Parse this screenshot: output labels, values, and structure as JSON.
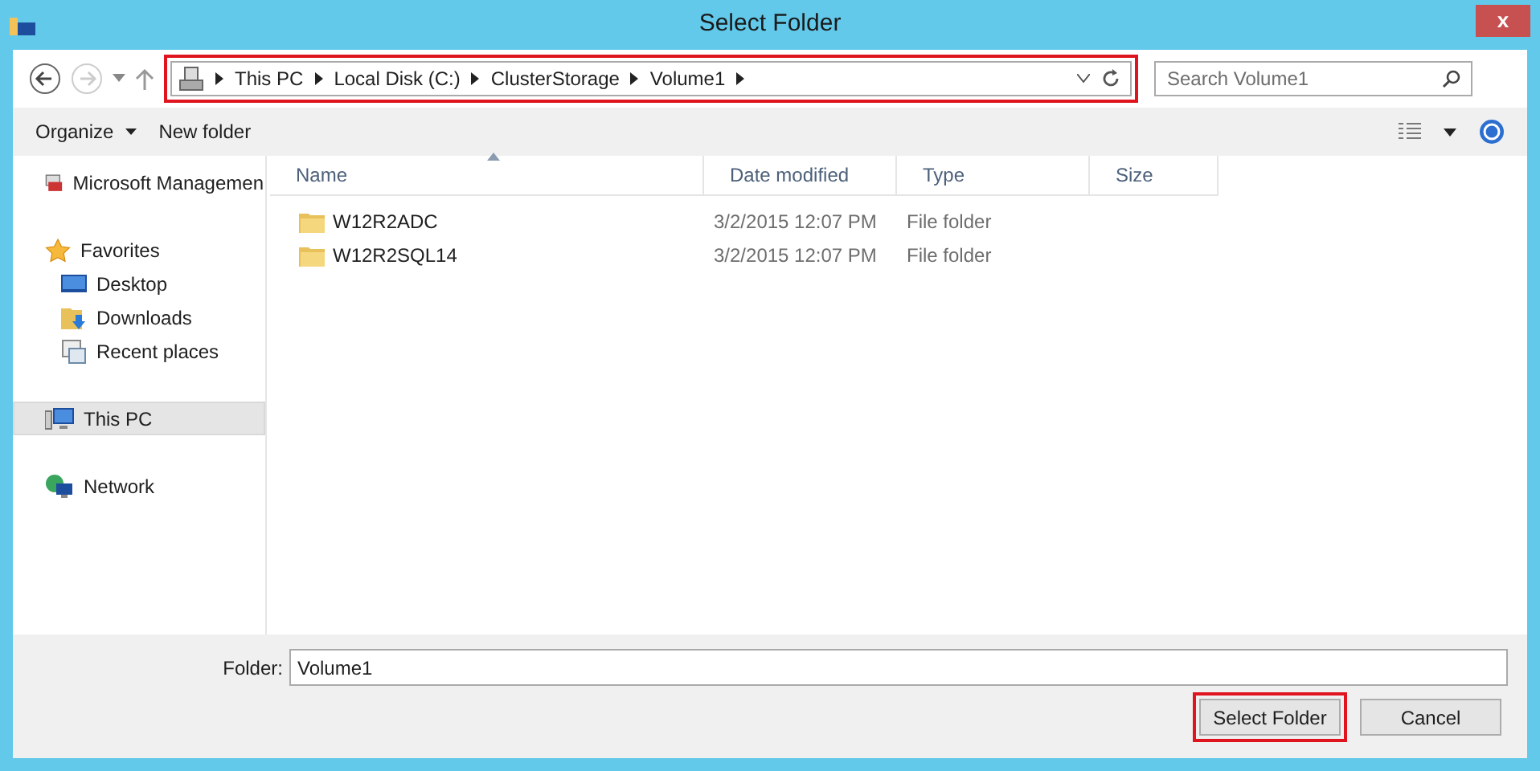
{
  "window": {
    "title": "Select Folder",
    "close": "x"
  },
  "address_bar": {
    "highlighted": true,
    "crumbs": [
      "This PC",
      "Local Disk (C:)",
      "ClusterStorage",
      "Volume1"
    ]
  },
  "search": {
    "placeholder": "Search Volume1"
  },
  "toolbar": {
    "organize": "Organize",
    "new_folder": "New folder"
  },
  "sidebar": {
    "items": [
      {
        "label": "Microsoft Managemen",
        "kind": "console",
        "selected": false
      },
      {
        "label": "Favorites",
        "kind": "star",
        "selected": false,
        "children": [
          {
            "label": "Desktop",
            "kind": "desktop",
            "selected": false
          },
          {
            "label": "Downloads",
            "kind": "downloads",
            "selected": false
          },
          {
            "label": "Recent places",
            "kind": "recent",
            "selected": false
          }
        ]
      },
      {
        "label": "This PC",
        "kind": "pc",
        "selected": true
      },
      {
        "label": "Network",
        "kind": "network",
        "selected": false
      }
    ]
  },
  "table": {
    "columns": [
      {
        "label": "Name",
        "sorted": true
      },
      {
        "label": "Date modified",
        "sorted": false
      },
      {
        "label": "Type",
        "sorted": false
      },
      {
        "label": "Size",
        "sorted": false
      }
    ],
    "rows": [
      {
        "name": "W12R2ADC",
        "date": "3/2/2015 12:07 PM",
        "type": "File folder"
      },
      {
        "name": "W12R2SQL14",
        "date": "3/2/2015 12:07 PM",
        "type": "File folder"
      }
    ]
  },
  "folder_field": {
    "label": "Folder:",
    "value": "Volume1"
  },
  "buttons": [
    {
      "label": "Select Folder",
      "highlighted": true
    },
    {
      "label": "Cancel",
      "highlighted": false
    }
  ]
}
